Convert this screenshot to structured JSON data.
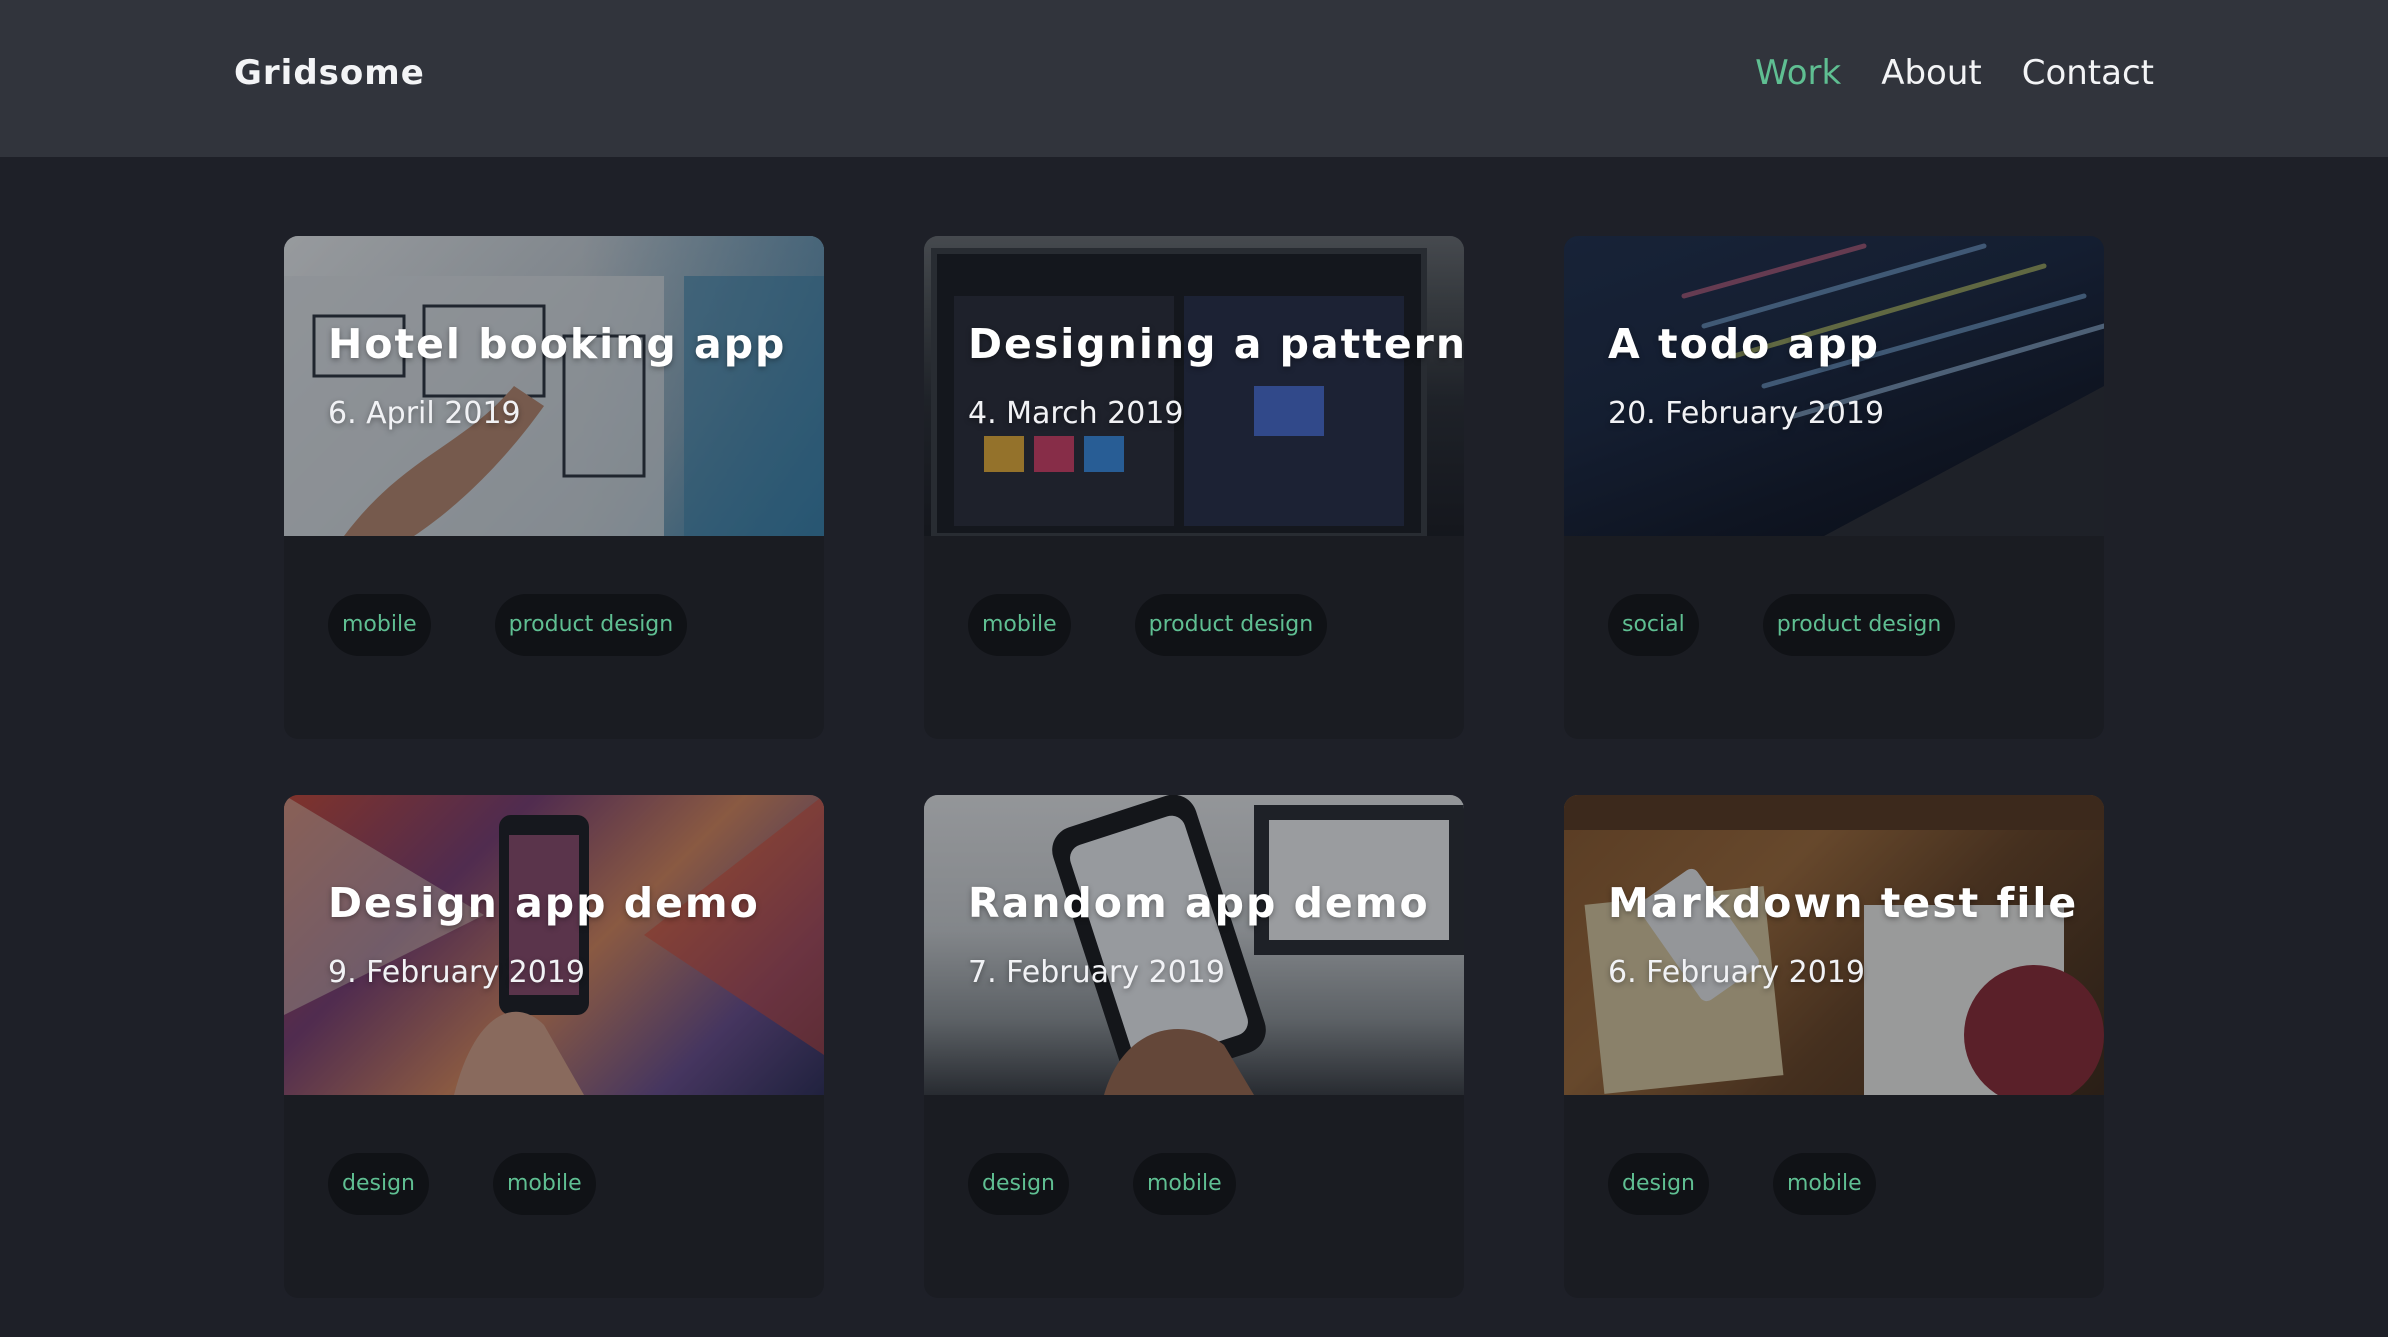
{
  "header": {
    "brand": "Gridsome",
    "nav": [
      {
        "label": "Work",
        "active": true
      },
      {
        "label": "About",
        "active": false
      },
      {
        "label": "Contact",
        "active": false
      }
    ]
  },
  "colors": {
    "accent": "#5fbf92",
    "header_bg": "#31343c",
    "page_bg": "#1e2028",
    "card_bg": "#1a1c22",
    "tag_bg": "#101216"
  },
  "cards": [
    {
      "title": "Hotel booking app",
      "date": "6. April 2019",
      "tags": [
        "mobile",
        "product design"
      ]
    },
    {
      "title": "Designing a pattern",
      "date": "4. March 2019",
      "tags": [
        "mobile",
        "product design"
      ]
    },
    {
      "title": "A todo app",
      "date": "20. February 2019",
      "tags": [
        "social",
        "product design"
      ]
    },
    {
      "title": "Design app demo",
      "date": "9. February 2019",
      "tags": [
        "design",
        "mobile"
      ]
    },
    {
      "title": "Random app demo",
      "date": "7. February 2019",
      "tags": [
        "design",
        "mobile"
      ]
    },
    {
      "title": "Markdown test file",
      "date": "6. February 2019",
      "tags": [
        "design",
        "mobile"
      ]
    }
  ]
}
